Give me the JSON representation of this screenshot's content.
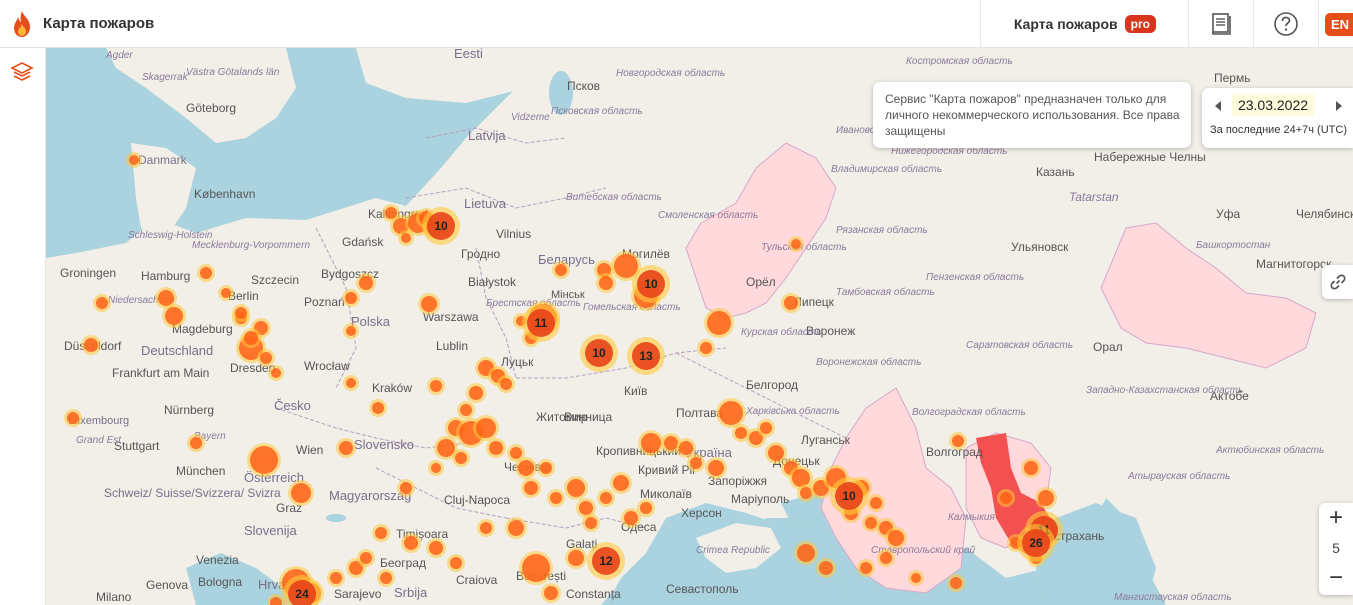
{
  "app": {
    "title": "Карта пожаров"
  },
  "header": {
    "pro_link_label": "Карта пожаров",
    "pro_badge": "pro",
    "lang_label": "EN"
  },
  "notice": {
    "text": "Сервис \"Карта пожаров\" предназначен только для личного некоммерческого использования. Все права защищены"
  },
  "date_panel": {
    "date": "23.03.2022",
    "range": "За последние 24+7ч (UTC)"
  },
  "zoom": {
    "in": "+",
    "level": "5",
    "out": "−"
  },
  "colors": {
    "accent": "#e54e1b",
    "fire_core": "#ff5a14",
    "fire_glow": "#ffc93a",
    "highlighted_region": "#ffd9dc",
    "burned_area": "#f24040",
    "water": "#aad3df",
    "land": "#f2efe9"
  },
  "icons": {
    "logo": "flame-icon",
    "layers": "layers-icon",
    "book": "book-icon",
    "help": "question-icon",
    "link": "link-icon",
    "prev": "caret-left-icon",
    "next": "caret-right-icon"
  },
  "fire_clusters": [
    "10",
    "10",
    "11",
    "10",
    "13",
    "10",
    "12",
    "11",
    "26",
    "24"
  ],
  "map": {
    "countries": [
      "Eesti",
      "Latvija",
      "Lietuva",
      "Беларусь",
      "Polska",
      "Deutschland",
      "Česko",
      "Slovensko",
      "Magyarország",
      "Österreich",
      "Україна",
      "Srbija",
      "Hrvatska",
      "Slovenija",
      "Schweiz/ Suisse/Svizzera/ Svizra",
      "Danmark",
      "Luxembourg"
    ],
    "cities": [
      "Псков",
      "Göteborg",
      "København",
      "Gdańsk",
      "Kaliningrad",
      "Vilnius",
      "Гродно",
      "Białystok",
      "Warszawa",
      "Lublin",
      "Bydgoszcz",
      "Poznań",
      "Szczecin",
      "Berlin",
      "Hamburg",
      "Groningen",
      "Magdeburg",
      "Düsseldorf",
      "Frankfurt am Main",
      "Nürnberg",
      "München",
      "Stuttgart",
      "Dresden",
      "Wrocław",
      "Kraków",
      "Wien",
      "Graz",
      "Venezia",
      "Bologna",
      "Genova",
      "Milano",
      "Sarajevo",
      "Београд",
      "Craiova",
      "București",
      "Constanța",
      "Cluj-Napoca",
      "Timișoara",
      "Galați",
      "Могилёв",
      "Орёл",
      "Липецк",
      "Воронеж",
      "Белгород",
      "Житомир",
      "Київ",
      "Винница",
      "Полтава",
      "Кропивницький",
      "Кривий Ріг",
      "Миколаїв",
      "Херсон",
      "Одеса",
      "Запоріжжя",
      "Маріуполь",
      "Донецьк",
      "Луганськ",
      "Волгоград",
      "Севастополь",
      "Казань",
      "Набережные Челны",
      "Уфа",
      "Челябинск",
      "Ульяновск",
      "Магнитогорск",
      "Орал",
      "Актобе",
      "Пермь",
      "Tatarstan",
      "Астрахань",
      "Луцьк",
      "Чернівці",
      "Мінськ"
    ],
    "regions": [
      "Новгородская область",
      "Псковская область",
      "Костромская область",
      "Смоленская область",
      "Тульская область",
      "Рязанская область",
      "Тамбовская область",
      "Пензенская область",
      "Курская область",
      "Воронежская область",
      "Саратовская область",
      "Волгоградская область",
      "Ставропольский край",
      "Калмыкия",
      "Западно-Казахстанская область",
      "Атырауская область",
      "Актюбинская область",
      "Башкортостан",
      "Нижегородская область",
      "Владимирская область",
      "Ивановская область",
      "Харківська область",
      "Витебская область",
      "Гомельская область",
      "Брестская область",
      "Мангистауская область"
    ],
    "seas": [
      "Agder",
      "Skagerrak",
      "Västra Götalands län",
      "Vidzeme",
      "Niedersachsen",
      "Mecklenburg-Vorpommern",
      "Schleswig-Holstein",
      "Bayern",
      "Grand Est",
      "Crimea Republic"
    ]
  }
}
